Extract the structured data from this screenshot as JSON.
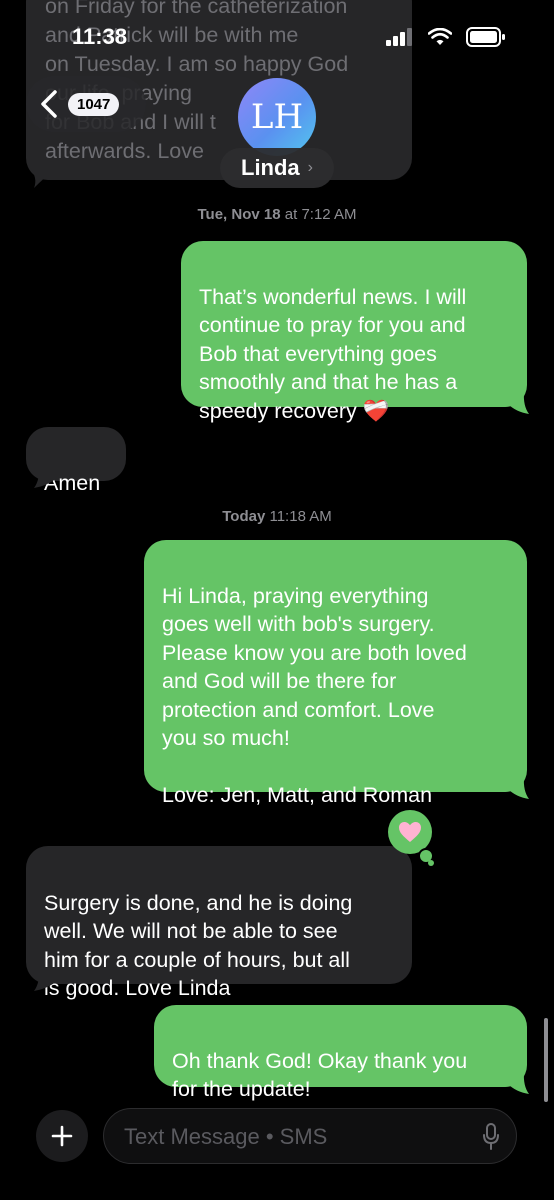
{
  "status_bar": {
    "time": "11:38"
  },
  "nav": {
    "back_count": "1047",
    "avatar_initials": "LH",
    "contact_name": "Linda",
    "name_chevron": "›"
  },
  "messages": {
    "top_partial": "on Friday for the catheterization\nand  Patrick will be with me\non Tuesday.  I am so happy God\n           our life.         praying\nfor Bob and I will t\nafterwards.  Love",
    "stamp1_day": "Tue, Nov 18",
    "stamp1_time": "at 7:12 AM",
    "out1": "That’s wonderful news. I will\ncontinue to pray for you and\nBob that everything goes\nsmoothly and that he has a\nspeedy recovery ❤️‍🩹",
    "in1": "Amen",
    "stamp2_day": "Today",
    "stamp2_time": "11:18 AM",
    "out2": "Hi Linda, praying everything\ngoes well with bob's surgery.\nPlease know you are both loved\nand God will be there for\nprotection and comfort. Love\nyou so much!\n\nLove: Jen, Matt, and Roman",
    "in2": "Surgery is done, and he is doing\nwell.  We will not be able to see\nhim for a couple of hours, but all\nis good.  Love Linda",
    "out3": "Oh thank God! Okay thank you\nfor the update!",
    "tapback_icon": "pink-heart-icon"
  },
  "composer": {
    "placeholder": "Text Message • SMS"
  },
  "colors": {
    "outgoing_bubble": "#65c466",
    "incoming_bubble": "#262628",
    "background": "#000000",
    "timestamp": "#8e8e93"
  }
}
